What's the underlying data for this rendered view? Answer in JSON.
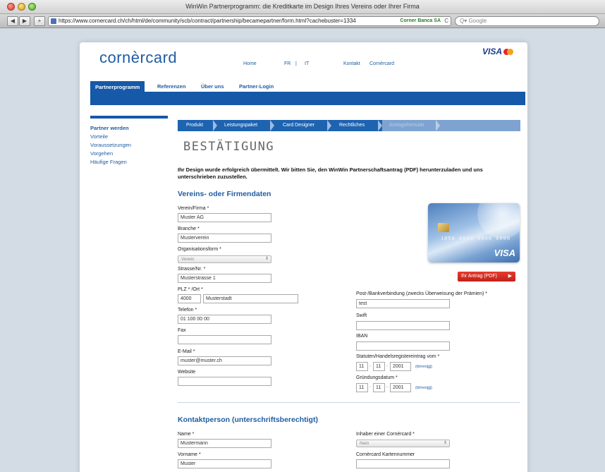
{
  "browser": {
    "window_title": "WinWin Partnerprogramm: die Kreditkarte im Design Ihres Vereins oder Ihrer Firma",
    "back": "◀",
    "forward": "▶",
    "add": "+",
    "url": "https://www.cornercard.ch/ch/html/de/community/scb/contract/partnership/becamepartner/form.html?cachebuster=1334",
    "cert": "Corner Banca SA",
    "reload": "C",
    "search_placeholder": "Q▾ Google"
  },
  "header": {
    "logo": "cornèrcard",
    "visa": "VISA",
    "links": [
      "Home",
      "FR",
      "|",
      "IT",
      "Kontakt",
      "Cornèrcard"
    ]
  },
  "mainnav": {
    "tabs": [
      "Partnerprogramm",
      "Referenzen",
      "Über uns",
      "Partner-Login"
    ]
  },
  "sidebar": {
    "items": [
      "Partner werden",
      "Vorteile",
      "Voraussetzungen",
      "Vorgehen",
      "Häufige Fragen"
    ]
  },
  "steps": [
    "Produkt",
    "Leistungspaket",
    "Card Designer",
    "Rechtliches",
    "Antragsformular"
  ],
  "page": {
    "title": "BESTÄTIGUNG",
    "intro": "Ihr Design wurde erfolgreich übermittelt. Wir bitten Sie, den WinWin Partnerschaftsantrag (PDF) herunterzuladen und uns unterschrieben zuzustellen."
  },
  "section1": {
    "heading": "Vereins- oder Firmendaten",
    "verein_label": "Verein/Firma *",
    "verein": "Muster AG",
    "branche_label": "Branche *",
    "branche": "Musterverein",
    "orgform_label": "Organisationsform *",
    "orgform": "Verein",
    "strasse_label": "Strasse/Nr. *",
    "strasse": "Musterstrasse 1",
    "plz_label": "PLZ * /Ort *",
    "plz": "4000",
    "ort": "Musterstadt",
    "telefon_label": "Telefon *",
    "telefon": "01 100 00 00",
    "fax_label": "Fax",
    "fax": "",
    "email_label": "E-Mail *",
    "email": "muster@muster.ch",
    "website_label": "Website",
    "website": "",
    "bank_label": "Post-/Bankverbindung (zwecks Überweisung der Prämien) *",
    "bank": "test",
    "swift_label": "Swift",
    "swift": "",
    "iban_label": "IBAN",
    "iban": "",
    "statuten_label": "Statuten/Handelsregistereintrag vom *",
    "statuten_d": "11",
    "statuten_m": "11",
    "statuten_y": "2001",
    "gruendung_label": "Gründungsdatum *",
    "gruendung_d": "11",
    "gruendung_m": "11",
    "gruendung_y": "2001",
    "date_fmt": "(tt/mm/jjjj)",
    "date_sep": "."
  },
  "card": {
    "number": "1050  0000  0000  0000",
    "visa": "VISA",
    "pdf_button": "Ihr Antrag (PDF)",
    "pdf_arrow": "▶"
  },
  "section2": {
    "heading": "Kontaktperson (unterschriftsberechtigt)",
    "name_label": "Name *",
    "name": "Mustermann",
    "vorname_label": "Vorname *",
    "vorname": "Muster",
    "inhaber_label": "Inhaber einer Cornèrcard *",
    "inhaber": "Nein",
    "kartennummer_label": "Cornèrcard Kartennummer",
    "kartennummer": ""
  },
  "colors": {
    "brand_blue": "#1559a8",
    "pdf_red": "#d42b22"
  }
}
